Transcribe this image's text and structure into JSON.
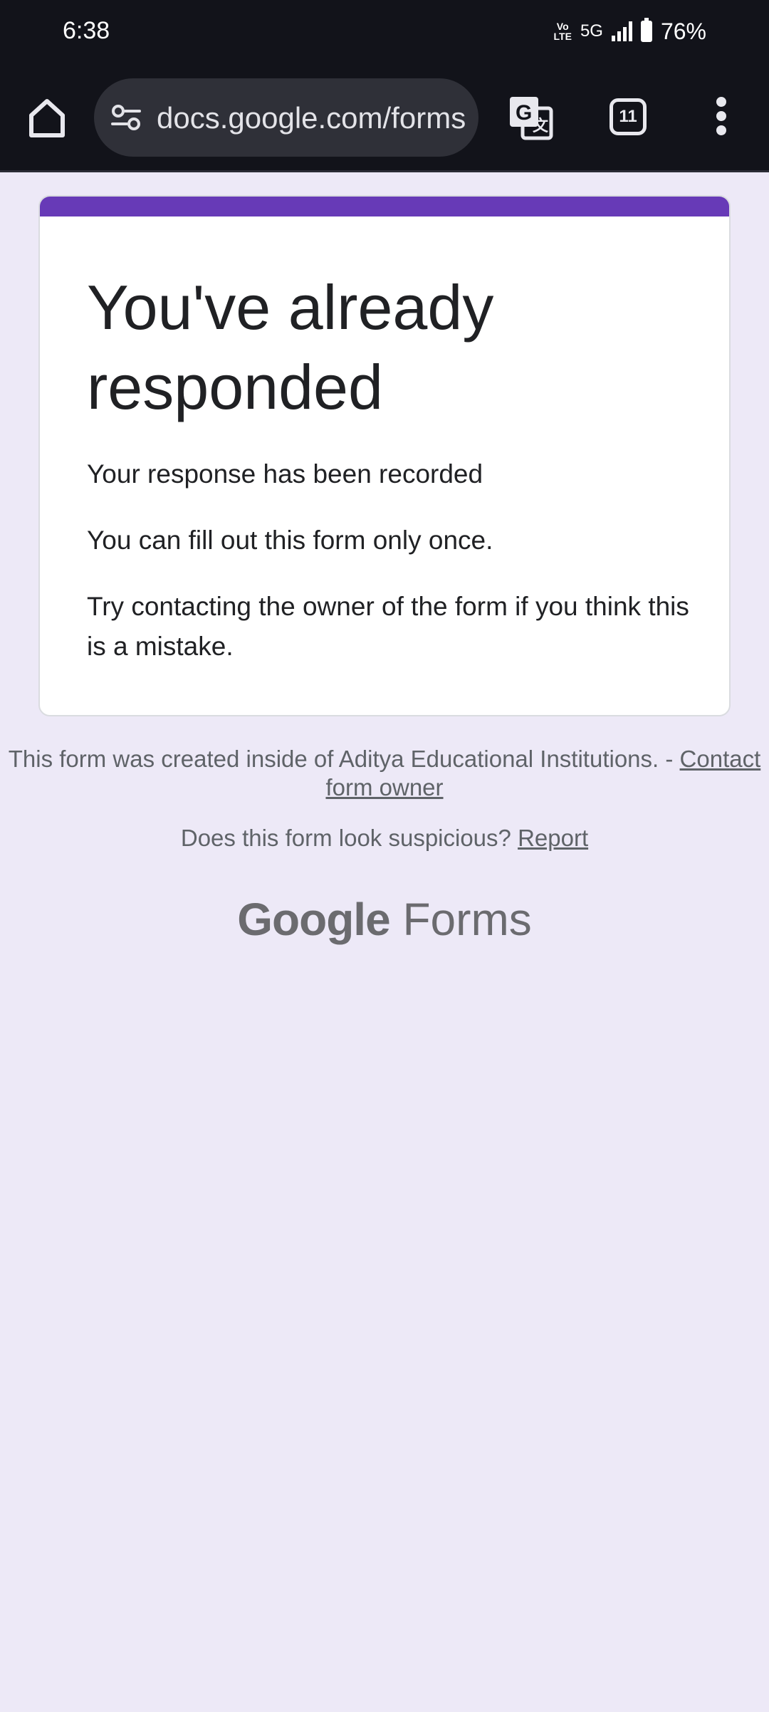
{
  "status_bar": {
    "time": "6:38",
    "volte": "Vo LTE",
    "network": "5G",
    "battery": "76%"
  },
  "browser": {
    "url": "docs.google.com/forms",
    "tab_count": "11"
  },
  "card": {
    "title": "You've already responded",
    "line1": "Your response has been recorded",
    "line2": "You can fill out this form only once.",
    "line3": "Try contacting the owner of the form if you think this is a mistake."
  },
  "footer": {
    "created_text": "This form was created inside of Aditya Educational Institutions.",
    "dash": " - ",
    "contact_link": "Contact form owner",
    "suspicious_text": "Does this form look suspicious?",
    "report_link": "Report"
  },
  "brand": {
    "google": "Google",
    "forms": "Forms"
  },
  "colors": {
    "accent": "#673ab7",
    "page_bg": "#ede9f7",
    "toolbar_bg": "#12131a"
  }
}
